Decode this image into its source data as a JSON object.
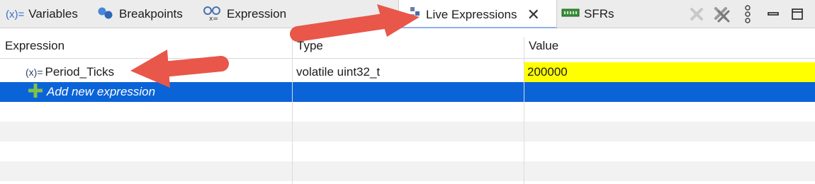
{
  "tabs": [
    {
      "label": "Variables",
      "icon": "variables-icon"
    },
    {
      "label": "Breakpoints",
      "icon": "breakpoints-icon"
    },
    {
      "label": "Expression",
      "icon": "expressions-icon"
    },
    {
      "label": "Live Expressions",
      "icon": "live-expressions-icon",
      "active": true
    },
    {
      "label": "SFRs",
      "icon": "sfrs-icon"
    }
  ],
  "toolbar": {
    "icons": [
      "remove-icon",
      "remove-all-icon",
      "view-menu-icon",
      "minimize-icon",
      "maximize-icon"
    ]
  },
  "table": {
    "columns": [
      "Expression",
      "Type",
      "Value"
    ],
    "rows": [
      {
        "expression": "Period_Ticks",
        "type": "volatile uint32_t",
        "value": "200000",
        "value_highlight": "#ffff00"
      }
    ],
    "add_row_label": "Add new expression",
    "selected_row_color": "#0b63d8"
  }
}
